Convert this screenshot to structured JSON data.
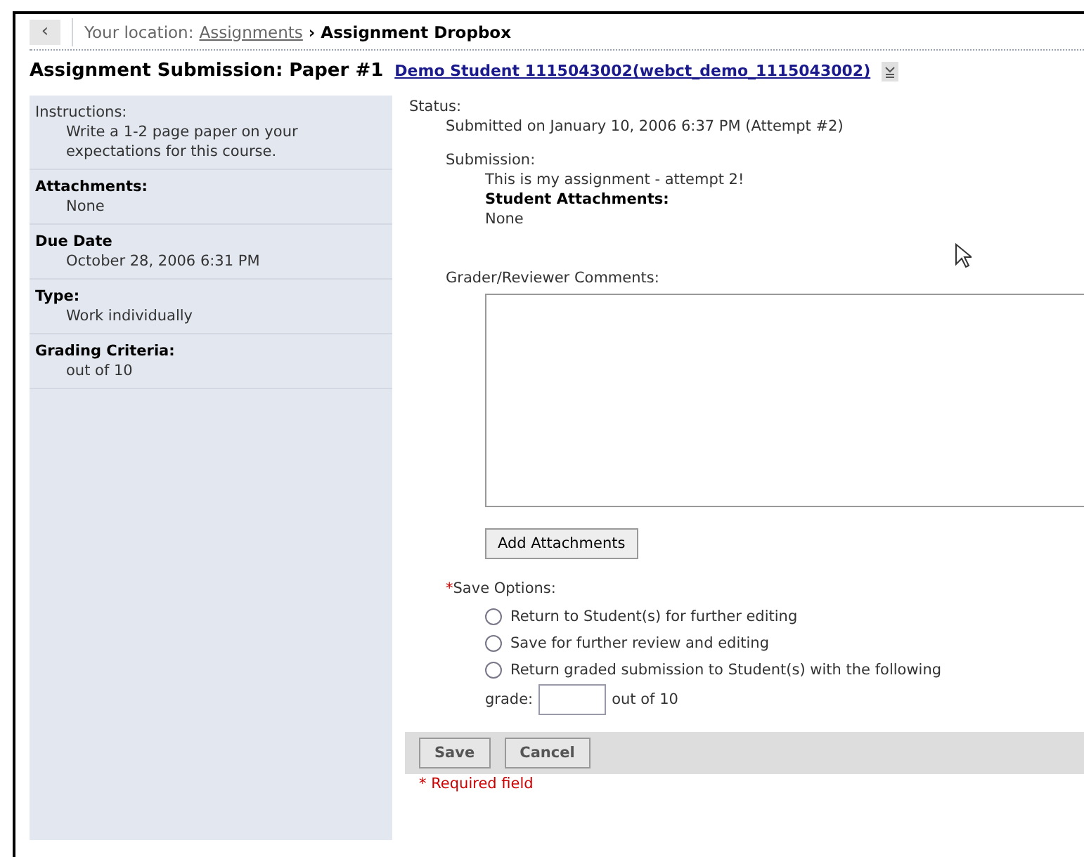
{
  "breadcrumb": {
    "back": "‹",
    "prefix": "Your location:",
    "link": "Assignments",
    "separator": "›",
    "current": "Assignment Dropbox"
  },
  "heading": {
    "title": "Assignment Submission: Paper #1",
    "student_link": "Demo Student 1115043002(webct_demo_1115043002)"
  },
  "sidebar": [
    {
      "label": "Instructions:",
      "emphasis": false,
      "value": "Write a 1-2 page paper on your expectations for this course."
    },
    {
      "label": "Attachments:",
      "emphasis": true,
      "value": "None"
    },
    {
      "label": "Due Date",
      "emphasis": true,
      "value": "October 28, 2006 6:31 PM"
    },
    {
      "label": "Type:",
      "emphasis": true,
      "value": "Work individually"
    },
    {
      "label": "Grading Criteria:",
      "emphasis": true,
      "value": "out of 10"
    }
  ],
  "status": {
    "label": "Status:",
    "value": "Submitted on January 10, 2006 6:37 PM (Attempt #2)"
  },
  "submission": {
    "label": "Submission:",
    "text": "This is my assignment - attempt 2!",
    "attachments_label": "Student Attachments:",
    "attachments_value": "None"
  },
  "comments": {
    "label": "Grader/Reviewer Comments:"
  },
  "add_attachments": "Add Attachments",
  "save_options": {
    "required_mark": "*",
    "label": "Save Options:",
    "options": [
      {
        "label": "Return to Student(s) for further editing",
        "selected": false
      },
      {
        "label": "Save for further review and editing",
        "selected": false
      },
      {
        "label": "Return graded submission to Student(s) with the following",
        "selected": false
      }
    ],
    "grade_label": "grade:",
    "grade_suffix": "out of 10"
  },
  "buttons": [
    "Save",
    "Cancel"
  ],
  "required_note": "* Required field"
}
